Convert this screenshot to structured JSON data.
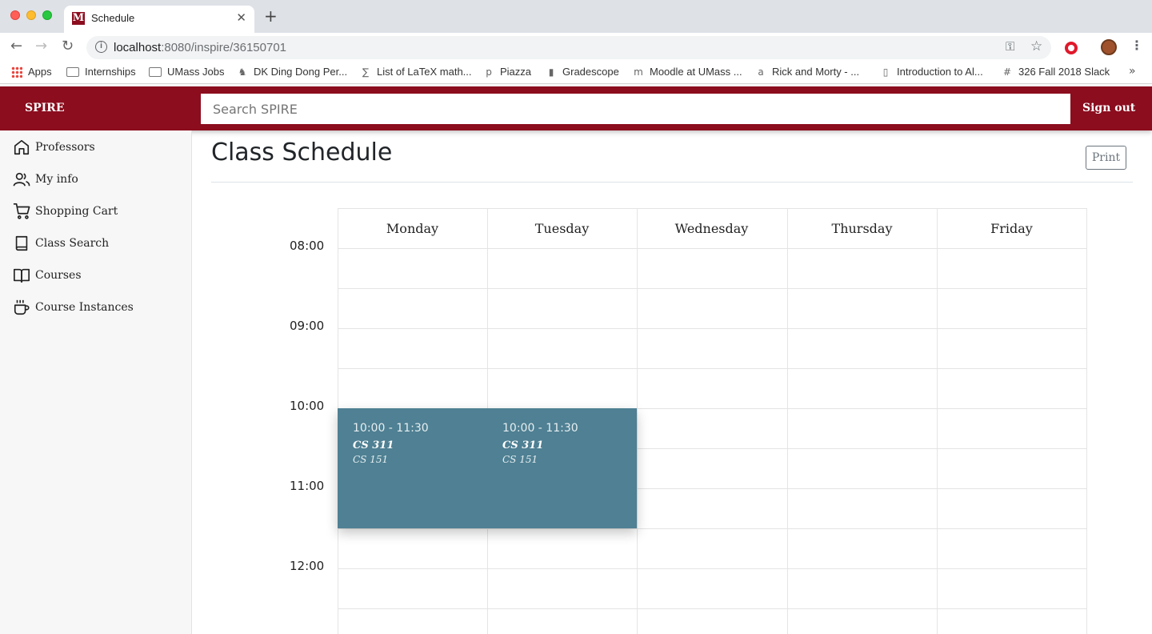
{
  "browser": {
    "tab_title": "Schedule",
    "url_host": "localhost",
    "url_path": ":8080/inspire/36150701",
    "bookmarks": [
      {
        "label": "Apps",
        "icon": "apps-grid-icon"
      },
      {
        "label": "Internships",
        "icon": "folder-icon"
      },
      {
        "label": "UMass Jobs",
        "icon": "folder-icon"
      },
      {
        "label": "DK Ding Dong Per...",
        "icon": "dk-favicon-icon"
      },
      {
        "label": "List of LaTeX math...",
        "icon": "latex-favicon-icon"
      },
      {
        "label": "Piazza",
        "icon": "piazza-favicon-icon"
      },
      {
        "label": "Gradescope",
        "icon": "gradescope-favicon-icon"
      },
      {
        "label": "Moodle at UMass ...",
        "icon": "moodle-favicon-icon"
      },
      {
        "label": "Rick and Morty - ...",
        "icon": "as-favicon-icon"
      },
      {
        "label": "Introduction to Al...",
        "icon": "page-icon"
      },
      {
        "label": "326 Fall 2018 Slack",
        "icon": "slack-favicon-icon"
      }
    ]
  },
  "header": {
    "brand": "SPIRE",
    "search_placeholder": "Search SPIRE",
    "signout_label": "Sign out",
    "accent_color": "#8b0d1e"
  },
  "sidebar": {
    "items": [
      {
        "label": "Professors",
        "icon": "home-icon"
      },
      {
        "label": "My info",
        "icon": "users-icon"
      },
      {
        "label": "Shopping Cart",
        "icon": "cart-icon"
      },
      {
        "label": "Class Search",
        "icon": "book-icon"
      },
      {
        "label": "Courses",
        "icon": "open-book-icon"
      },
      {
        "label": "Course Instances",
        "icon": "coffee-icon"
      }
    ]
  },
  "main": {
    "title": "Class Schedule",
    "print_label": "Print"
  },
  "calendar": {
    "days": [
      "Monday",
      "Tuesday",
      "Wednesday",
      "Thursday",
      "Friday"
    ],
    "times": [
      "08:00",
      "09:00",
      "10:00",
      "11:00",
      "12:00"
    ],
    "event_color": "#4f8093",
    "events": [
      {
        "day": "Monday",
        "time": "10:00 - 11:30",
        "course": "CS 311",
        "subtitle": "CS 151"
      },
      {
        "day": "Tuesday",
        "time": "10:00 - 11:30",
        "course": "CS 311",
        "subtitle": "CS 151"
      }
    ]
  }
}
